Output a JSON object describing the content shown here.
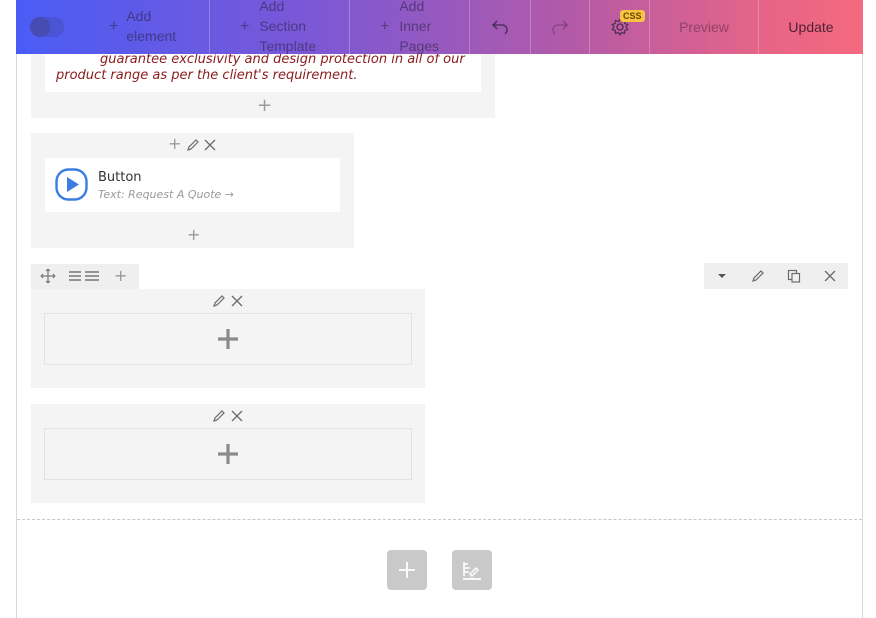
{
  "navbar": {
    "add_element": [
      "Add",
      "element"
    ],
    "add_section_template": [
      "Add",
      "Section",
      "Template"
    ],
    "add_inner_pages": [
      "Add",
      "Inner",
      "Pages"
    ],
    "css_badge": "CSS",
    "preview": "Preview",
    "update": "Update"
  },
  "text_block": {
    "line1": "guarantee exclusivity and design protection in all of our",
    "line2": "product range as per the client's requirement."
  },
  "button_element": {
    "title": "Button",
    "subtitle": "Text: Request A Quote →"
  },
  "colors": {
    "nav_gradient_start": "#4a5cf5",
    "nav_gradient_end": "#f46a7e",
    "quote_text": "#8a1c1c",
    "play_icon": "#3b7de0",
    "css_badge": "#f6c343"
  }
}
